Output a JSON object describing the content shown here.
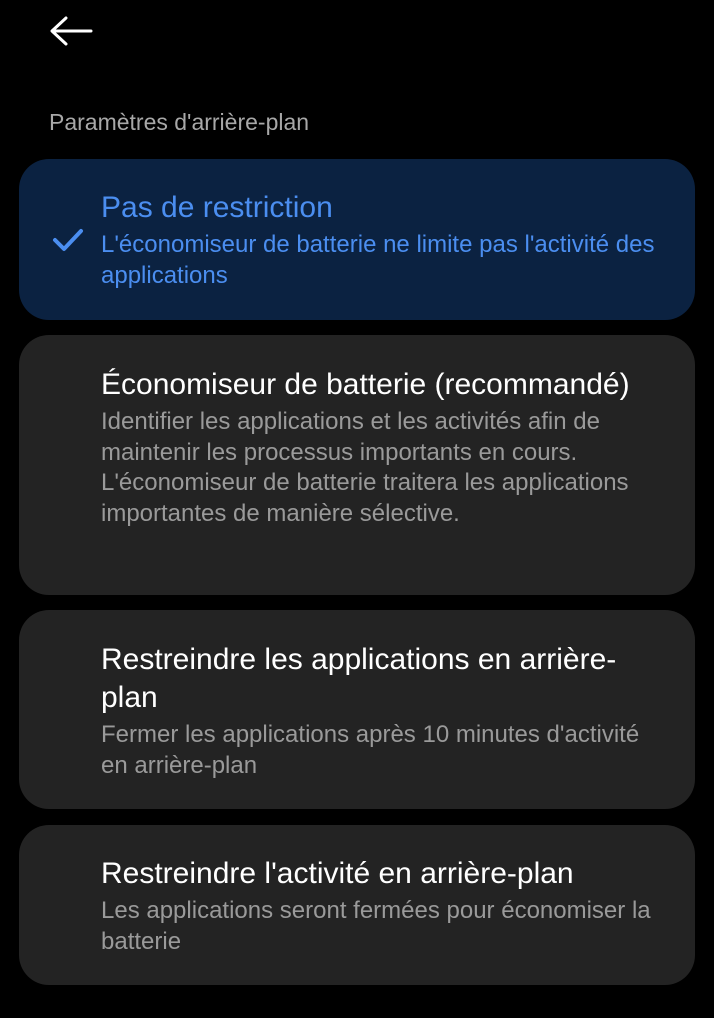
{
  "header": {
    "back_icon": "arrow-left-icon"
  },
  "section": {
    "title": "Paramètres d'arrière-plan"
  },
  "options": [
    {
      "title": "Pas de restriction",
      "description": "L'économiseur de batterie ne limite pas l'activité des applications",
      "selected": true,
      "icon": "checkmark-icon"
    },
    {
      "title": "Économiseur de batterie (recommandé)",
      "description": "Identifier les applications et les activités afin de maintenir les processus importants en cours. L'économiseur de batterie traitera les applications importantes de manière sélective.",
      "selected": false
    },
    {
      "title": "Restreindre les applications en arrière-plan",
      "description": "Fermer les applications après 10 minutes d'activité en arrière-plan",
      "selected": false
    },
    {
      "title": "Restreindre l'activité en arrière-plan",
      "description": "Les applications seront fermées pour économiser la batterie",
      "selected": false
    }
  ],
  "colors": {
    "background": "#000000",
    "card": "#232323",
    "selected_card": "#0b2241",
    "accent": "#4b8ef0",
    "secondary_text": "#9a9a9a"
  }
}
